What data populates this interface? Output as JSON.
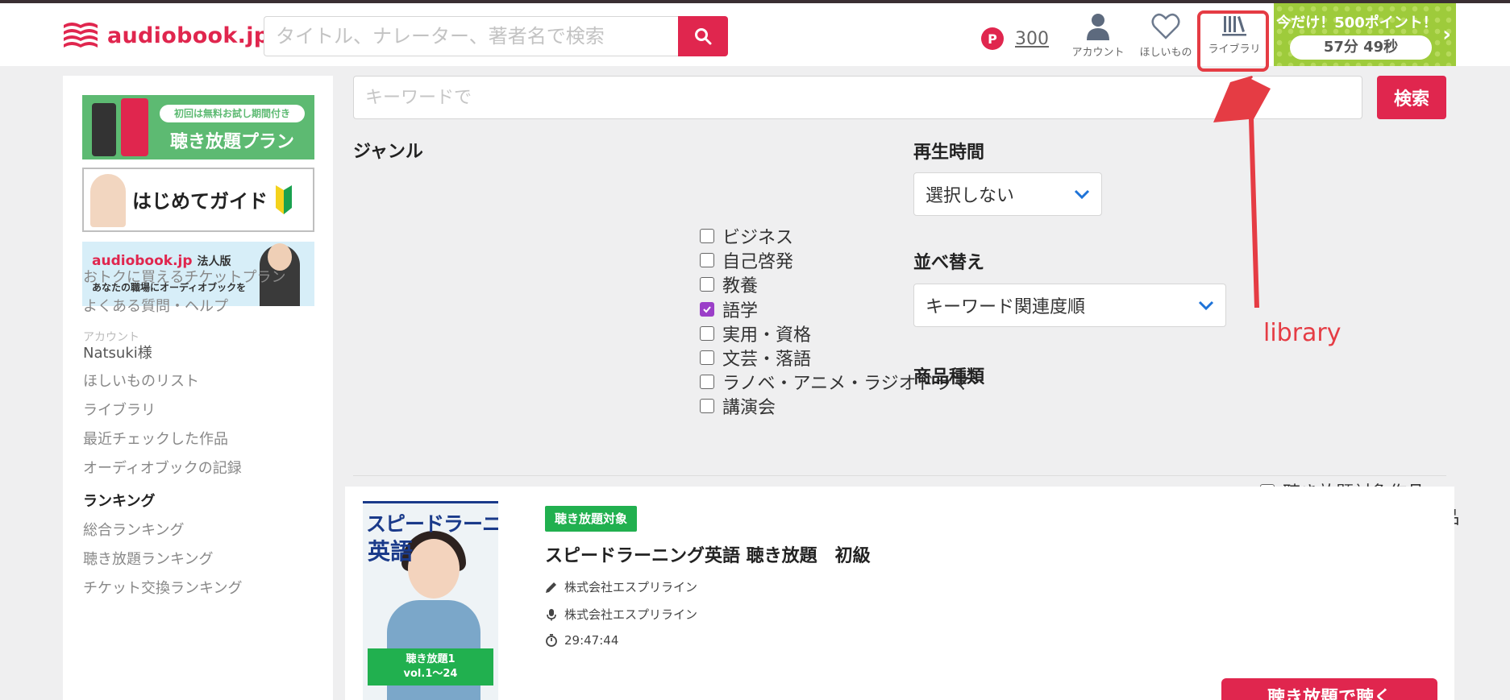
{
  "header": {
    "logo_text": "audiobook.jp",
    "search_placeholder": "タイトル、ナレーター、著者名で検索",
    "points_badge": "P",
    "points_value": "300",
    "nav": {
      "account_label": "アカウント",
      "wishlist_label": "ほしいもの",
      "library_label": "ライブラリ"
    },
    "promo": {
      "title": "今だけ！500ポイント！",
      "timer": "57分 49秒"
    }
  },
  "sidebar": {
    "banners": {
      "plan_pill": "初回は無料お試し期間付き",
      "plan_text": "聴き放題プラン",
      "guide_text": "はじめてガイド",
      "corp_logo": "audiobook.jp",
      "corp_suffix": "法人版",
      "corp_sub": "あなたの職場にオーディオブックを"
    },
    "links_top": [
      "おトクに買えるチケットプラン",
      "よくある質問・ヘルプ"
    ],
    "account_heading": "アカウント",
    "user_name": "Natsuki様",
    "account_links": [
      "ほしいものリスト",
      "ライブラリ",
      "最近チェックした作品",
      "オーディオブックの記録"
    ],
    "ranking_heading": "ランキング",
    "ranking_links": [
      "総合ランキング",
      "聴き放題ランキング",
      "チケット交換ランキング"
    ]
  },
  "filters": {
    "keyword_placeholder": "キーワードで",
    "search_button": "検索",
    "genre_title": "ジャンル",
    "genres": [
      {
        "label": "ビジネス",
        "checked": false
      },
      {
        "label": "自己啓発",
        "checked": false
      },
      {
        "label": "教養",
        "checked": false
      },
      {
        "label": "語学",
        "checked": true
      },
      {
        "label": "実用・資格",
        "checked": false
      },
      {
        "label": "文芸・落語",
        "checked": false
      },
      {
        "label": "ラノベ・アニメ・ラジオドラマ",
        "checked": false
      },
      {
        "label": "講演会",
        "checked": false
      }
    ],
    "duration_title": "再生時間",
    "duration_value": "選択しない",
    "sort_title": "並べ替え",
    "sort_value": "キーワード関連度順",
    "type_title": "商品種類",
    "types": [
      {
        "label": "聴き放題対象作品",
        "checked": false
      },
      {
        "label": "チケットが使える作品",
        "checked": false
      }
    ]
  },
  "result": {
    "cover_line1": "スピードラーニング",
    "cover_line2": "英語",
    "cover_band1": "聴き放題1",
    "cover_band2": "vol.1〜24",
    "badge": "聴き放題対象",
    "title": "スピードラーニング英語 聴き放題　初級",
    "author": "株式会社エスプリライン",
    "narrator": "株式会社エスプリライン",
    "duration": "29:47:44",
    "listen_button": "聴き放題で聴く"
  },
  "annotation": {
    "label": "library",
    "color": "#e53c44"
  },
  "colors": {
    "brand": "#e0264e",
    "free_badge": "#21b04f",
    "promo": "#9ecb3b"
  }
}
